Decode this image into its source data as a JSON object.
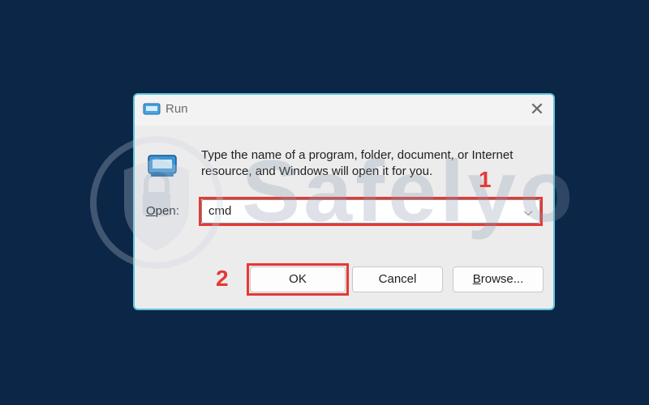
{
  "dialog": {
    "title": "Run",
    "close_glyph": "✕",
    "description": "Type the name of a program, folder, document, or Internet resource, and Windows will open it for you.",
    "open_label_mnemonic": "O",
    "open_label_rest": "pen:",
    "command_value": "cmd",
    "chevron": "⌵",
    "buttons": {
      "ok": "OK",
      "cancel": "Cancel",
      "browse_mnemonic": "B",
      "browse_rest": "rowse..."
    }
  },
  "annotations": {
    "step1": "1",
    "step2": "2",
    "highlight_color": "#e53935"
  },
  "watermark": {
    "text": "Safelyo"
  },
  "colors": {
    "background": "#0c2647",
    "dialog_border": "#5ec3dc"
  },
  "icons": {
    "title": "run-icon",
    "body": "run-icon",
    "close": "close-icon",
    "dropdown": "chevron-down-icon",
    "watermark_logo": "lock-shield-icon"
  }
}
